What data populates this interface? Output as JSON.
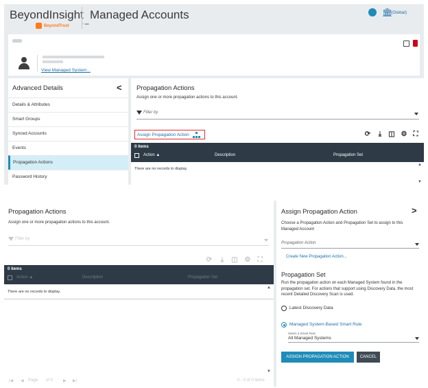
{
  "header": {
    "product": "BeyondInsight",
    "logo_text": "BeyondTrust",
    "page_title": "Managed Accounts",
    "scope": "(Global)",
    "colors": {
      "brand_orange": "#ff7a1a",
      "link_blue": "#1f6fa6",
      "accent": "#1f8bb8",
      "dark_bar": "#2e3b46",
      "danger": "#d0021b"
    }
  },
  "account": {
    "view_link": "View Managed System..."
  },
  "advanced": {
    "title": "Advanced Details",
    "items": [
      {
        "label": "Details & Attributes"
      },
      {
        "label": "Smart Groups"
      },
      {
        "label": "Synced Accounts"
      },
      {
        "label": "Events"
      },
      {
        "label": "Propagation Actions",
        "active": true
      },
      {
        "label": "Password History"
      }
    ]
  },
  "propagation": {
    "title": "Propagation Actions",
    "description": "Assign one or more propagation actions to this account.",
    "filter_placeholder": "Filter by",
    "assign_link": "Assign Propagation Action",
    "items_count": "0 items",
    "columns": [
      "Action",
      "Description",
      "Propagation Set"
    ],
    "sort_indicator": "▲",
    "empty_text": "There are no records to display."
  },
  "pager": {
    "page_label": "Page",
    "of_label": "of 0",
    "range": "0 - 0 of 0 items"
  },
  "assign_panel": {
    "title": "Assign Propagation Action",
    "description": "Choose a Propagation Action and Propagation Set to assign to this Managed Account",
    "select_placeholder": "Propagation Action",
    "create_link": "Create New Propagation Action...",
    "set_title": "Propagation Set",
    "set_description": "Run the propagation action on each Managed System found in the propagation set. For actions that support using Discovery Data, the most recent Detailed Discovery Scan is used.",
    "options": [
      {
        "label": "Latest Discovery Data",
        "selected": false
      },
      {
        "label": "Managed System-Based Smart Rule",
        "selected": true
      }
    ],
    "smart_rule_label": "Select a Smart Rule",
    "smart_rule_value": "All Managed Systems",
    "primary_button": "ASSIGN PROPAGATION ACTION",
    "cancel_button": "CANCEL"
  },
  "icons": [
    "user-icon",
    "bank-icon",
    "edit-icon",
    "trash-icon",
    "chevron-left-icon",
    "filter-icon",
    "org-chart-icon",
    "refresh-icon",
    "download-icon",
    "columns-icon",
    "gear-icon",
    "fullscreen-icon",
    "chevron-right-icon"
  ]
}
